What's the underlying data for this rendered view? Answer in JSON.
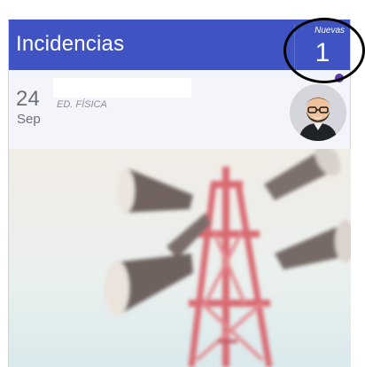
{
  "header": {
    "title": "Incidencias"
  },
  "new_badge": {
    "label": "Nuevas",
    "count": "1"
  },
  "item": {
    "day": "24",
    "month": "Sep",
    "subject": "ED. FÍSICA"
  },
  "colors": {
    "header": "#3f54c2",
    "unread_dot": "#5b3ca8"
  },
  "icons": {
    "avatar": "bearded-man-avatar-icon",
    "image": "loudspeaker-tower-photo"
  }
}
